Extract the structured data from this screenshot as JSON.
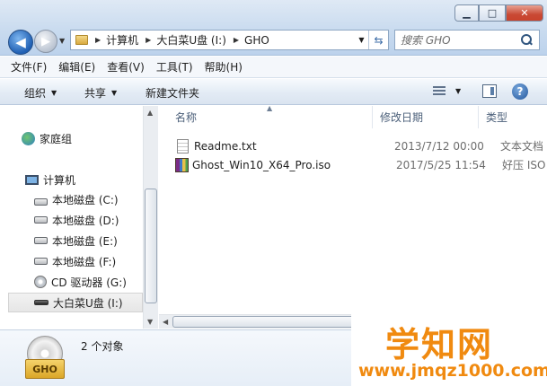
{
  "window": {
    "minimize_glyph": "▁",
    "maximize_glyph": "□",
    "close_glyph": "✕"
  },
  "address_bar": {
    "crumbs": [
      "计算机",
      "大白菜U盘 (I:)",
      "GHO"
    ]
  },
  "search": {
    "placeholder": "搜索 GHO"
  },
  "menu": {
    "items": [
      "文件(F)",
      "编辑(E)",
      "查看(V)",
      "工具(T)",
      "帮助(H)"
    ]
  },
  "command_bar": {
    "organize": "组织",
    "share": "共享",
    "new_folder": "新建文件夹",
    "help_glyph": "?"
  },
  "nav_pane": {
    "homegroup": "家庭组",
    "computer": "计算机",
    "drives": [
      "本地磁盘 (C:)",
      "本地磁盘 (D:)",
      "本地磁盘 (E:)",
      "本地磁盘 (F:)",
      "CD 驱动器 (G:)",
      "大白菜U盘 (I:)"
    ]
  },
  "columns": {
    "name": "名称",
    "date": "修改日期",
    "type": "类型"
  },
  "files": [
    {
      "name": "Readme.txt",
      "date": "2013/7/12 00:00",
      "type": "文本文档",
      "icon": "text-file-icon"
    },
    {
      "name": "Ghost_Win10_X64_Pro.iso",
      "date": "2017/5/25 11:54",
      "type": "好压 ISO 压",
      "icon": "archive-file-icon"
    }
  ],
  "details": {
    "icon_label": "GHO",
    "object_count": "2 个对象"
  },
  "watermark": {
    "title": "学知网",
    "url": "www.jmqz1000.com"
  },
  "colors": {
    "accent": "#3a6aa5",
    "watermark": "#f08a10",
    "close_button": "#c94a35"
  }
}
